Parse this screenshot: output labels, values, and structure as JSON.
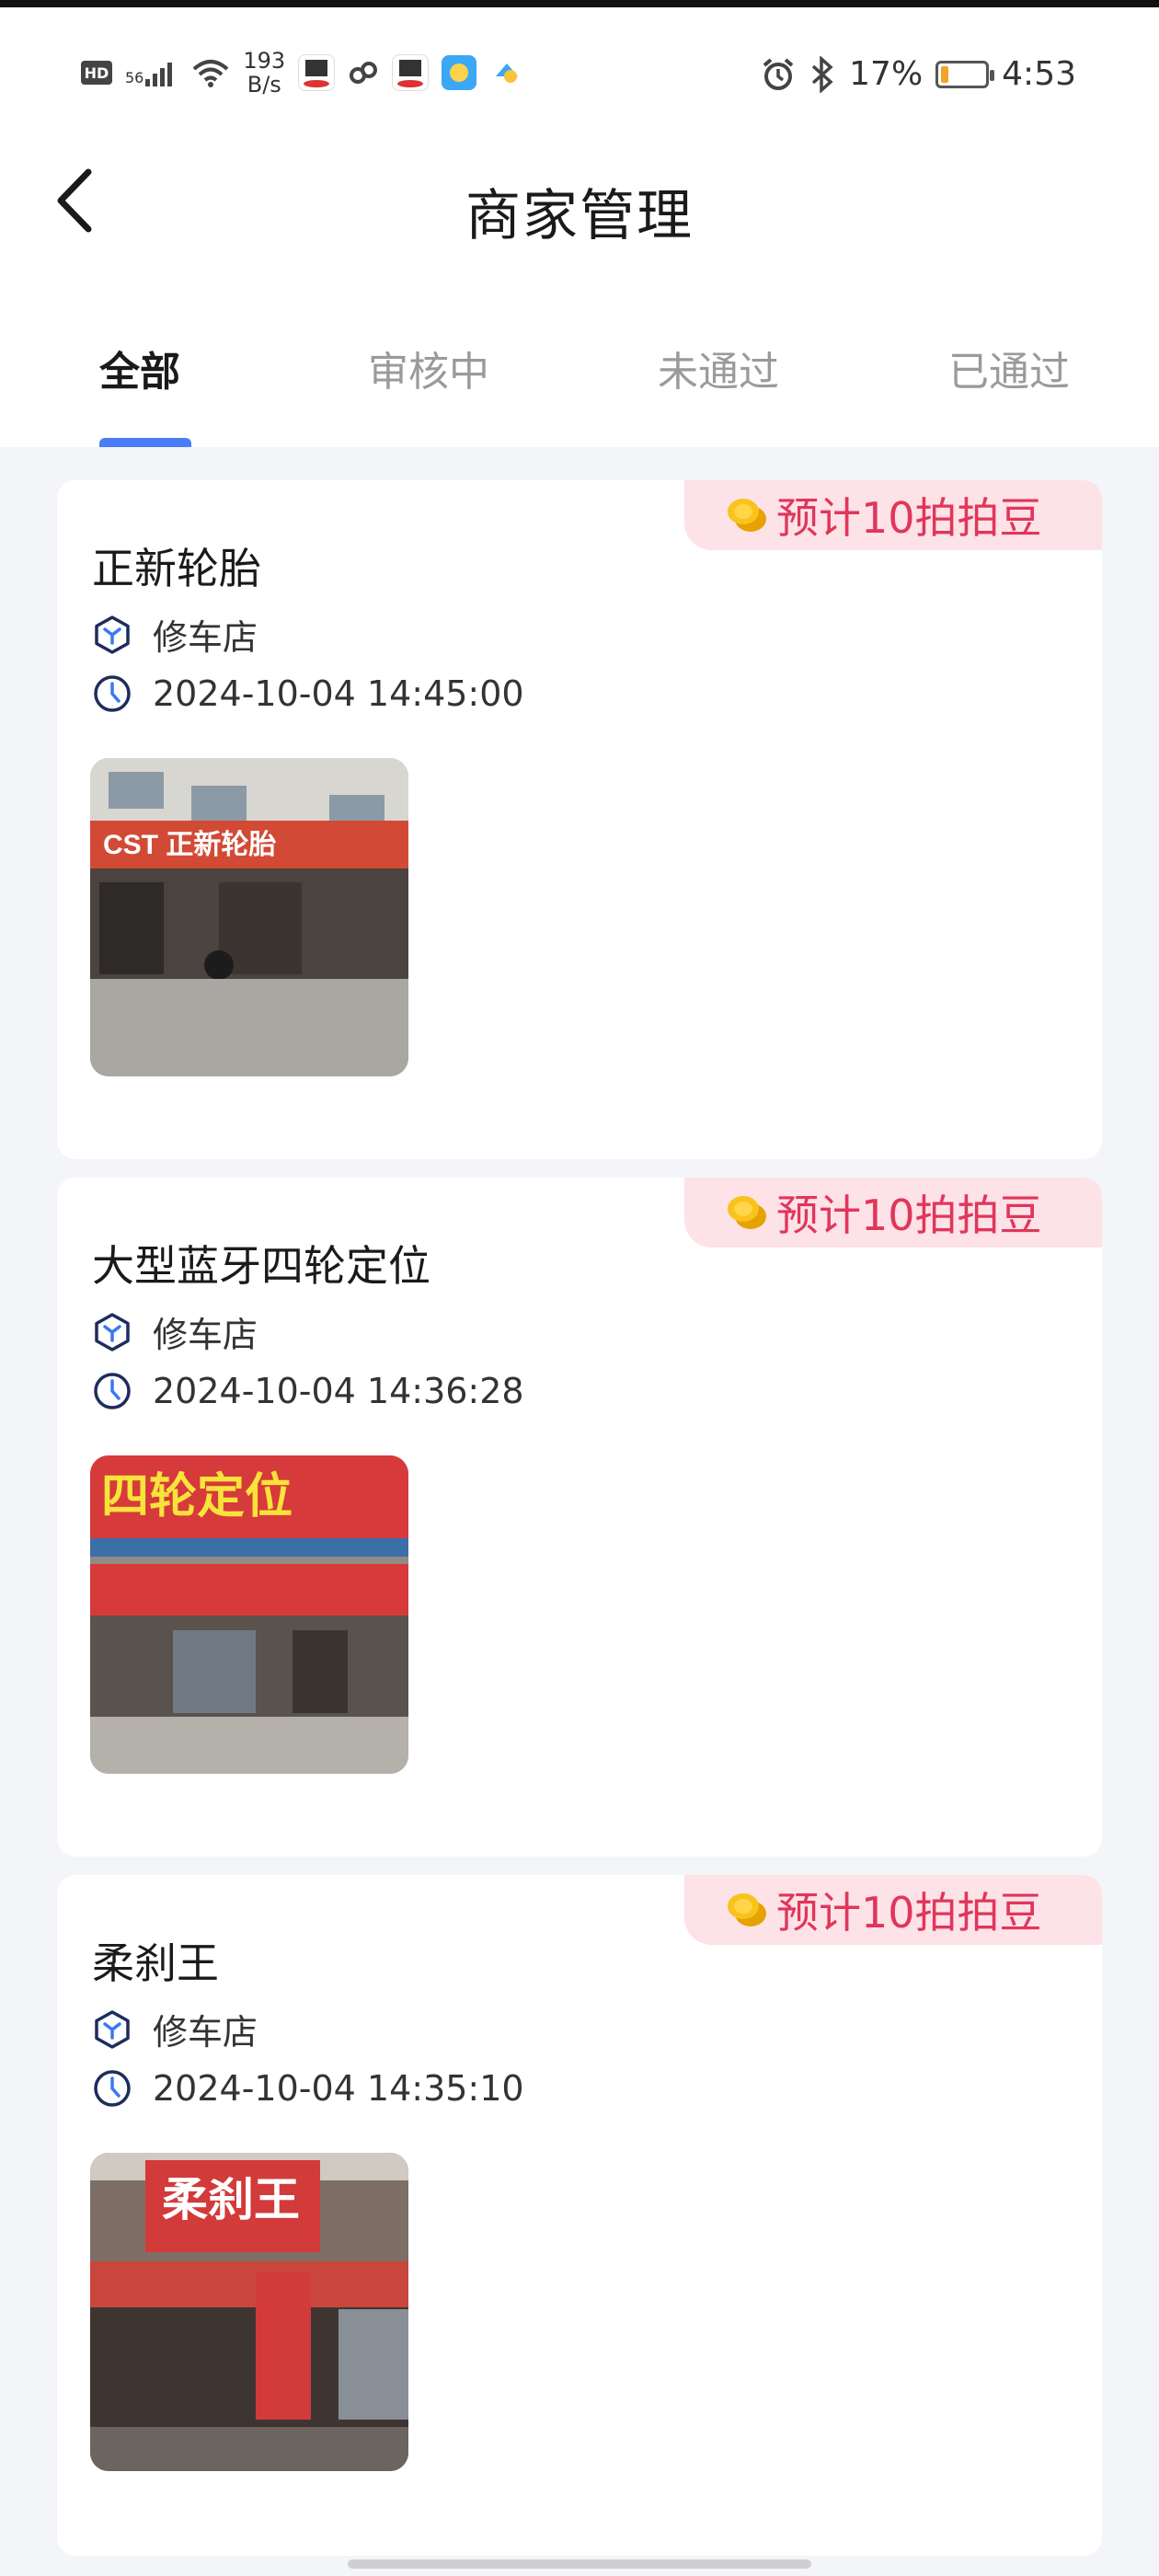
{
  "status_bar": {
    "hd": "HD",
    "network": "56",
    "speed_value": "193",
    "speed_unit": "B/s",
    "battery": "17%",
    "battery_level": 0.17,
    "time": "4:53"
  },
  "header": {
    "title": "商家管理"
  },
  "tabs": [
    {
      "label": "全部",
      "active": true
    },
    {
      "label": "审核中",
      "active": false
    },
    {
      "label": "未通过",
      "active": false
    },
    {
      "label": "已通过",
      "active": false
    }
  ],
  "merchants": [
    {
      "badge": "预计10拍拍豆",
      "name": "正新轮胎",
      "category": "修车店",
      "time": "2024-10-04 14:45:00",
      "sign": "CST 正新轮胎"
    },
    {
      "badge": "预计10拍拍豆",
      "name": "大型蓝牙四轮定位",
      "category": "修车店",
      "time": "2024-10-04 14:36:28",
      "sign": "四轮定位"
    },
    {
      "badge": "预计10拍拍豆",
      "name": "柔刹王",
      "category": "修车店",
      "time": "2024-10-04 14:35:10",
      "sign": "柔刹王"
    }
  ],
  "colors": {
    "accent": "#4a7df5",
    "badge_text": "#e0365a",
    "badge_bg": "#fde2e8",
    "background": "#f4f5f8"
  }
}
